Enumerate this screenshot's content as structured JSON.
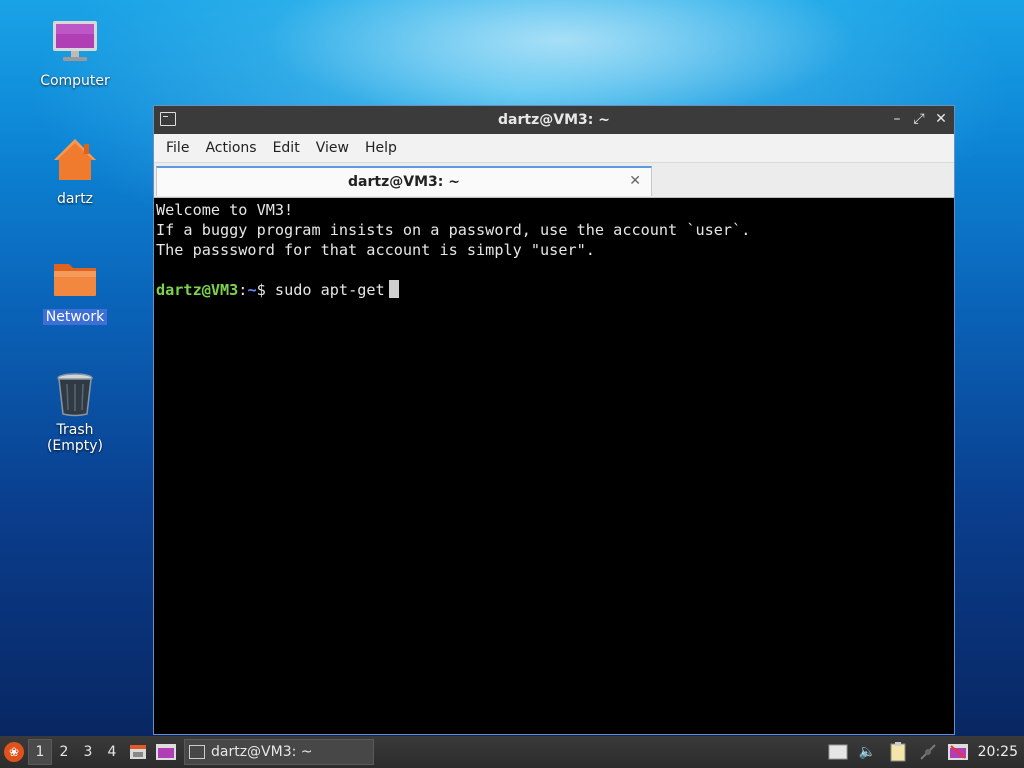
{
  "desktop": {
    "icons": [
      {
        "label": "Computer"
      },
      {
        "label": "dartz"
      },
      {
        "label": "Network"
      },
      {
        "label": "Trash (Empty)"
      }
    ]
  },
  "window": {
    "title": "dartz@VM3: ~",
    "controls": {
      "minimize": "–",
      "maximize": "⤢",
      "close": "✕"
    },
    "menu": [
      "File",
      "Actions",
      "Edit",
      "View",
      "Help"
    ],
    "tab": {
      "label": "dartz@VM3: ~",
      "close": "✕"
    },
    "terminal": {
      "lines": [
        "Welcome to VM3!",
        "If a buggy program insists on a password, use the account `user`.",
        "The passsword for that account is simply \"user\"."
      ],
      "prompt_user": "dartz@VM3",
      "prompt_sep": ":",
      "prompt_path": "~",
      "prompt_symbol": "$",
      "command": "sudo apt-get"
    }
  },
  "taskbar": {
    "workspaces": [
      "1",
      "2",
      "3",
      "4"
    ],
    "active_workspace": "1",
    "task_label": "dartz@VM3: ~",
    "clock": "20:25"
  }
}
